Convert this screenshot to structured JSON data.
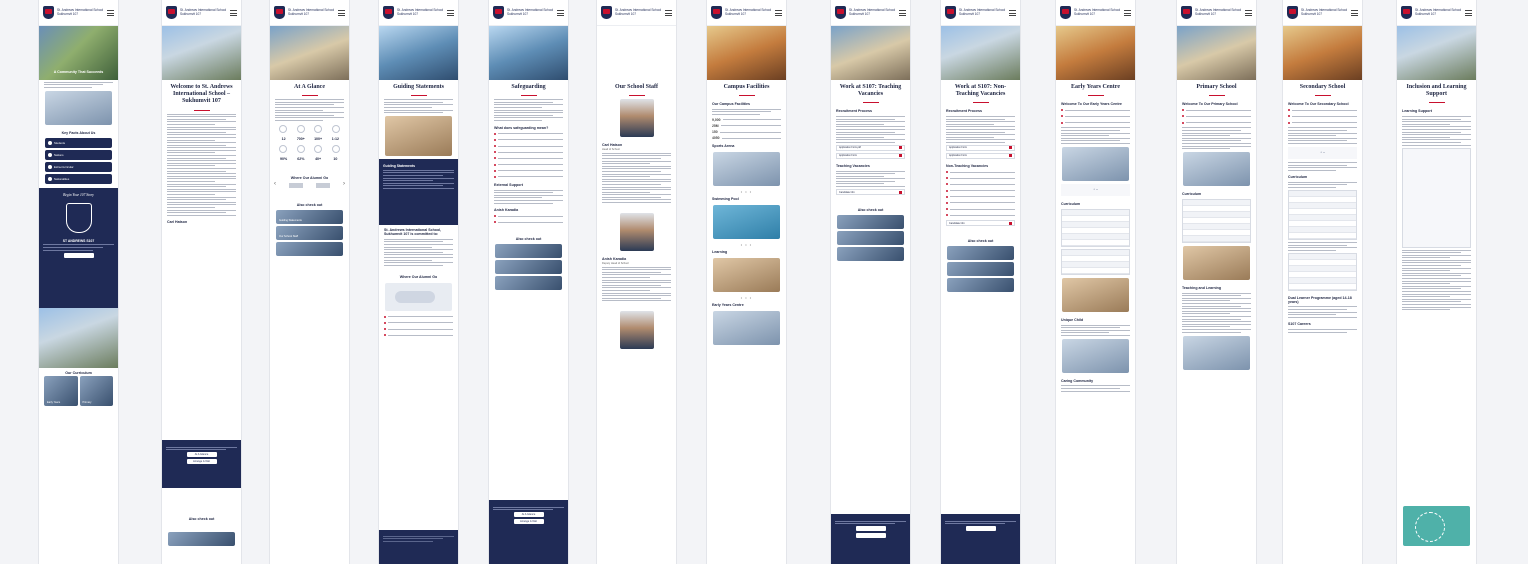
{
  "brand": "St. Andrews International School Sukhumvit 107",
  "screens": [
    {
      "id": "home",
      "hero_caption": "A Community That Succeeds",
      "title": "",
      "tags": [
        "Key Facts About Us",
        "Students",
        "Nations",
        "Extra-Curricular",
        "Nationalities"
      ],
      "extra": [
        "Our Curriculum",
        "Early Years",
        "Primary"
      ],
      "quote": "Begin Your 107 Story",
      "school_name": "ST ANDREWS S107"
    },
    {
      "id": "welcome",
      "title": "Welcome to St. Andrews International School – Sukhumvit 107",
      "sub": "Carl Hatson",
      "also": "Also check out",
      "buttons": [
        "At A Glance",
        "Arrange A Visit"
      ]
    },
    {
      "id": "glance",
      "title": "At A Glance",
      "nums": [
        "12",
        "700+",
        "100+",
        "1:12"
      ],
      "nums2": [
        "90%",
        "62%",
        "40+",
        "10"
      ],
      "sub": "Where Our Alumni Go",
      "also": "Also check out",
      "links": [
        "Guiding Statements",
        "Our School Staff"
      ]
    },
    {
      "id": "guiding",
      "title": "Guiding Statements",
      "sub": "Guiding Statements",
      "sub2": "St. Andrews International School, Sukhumvit 107 is committed to:",
      "also": "Also check out",
      "where": "Where Our Alumni Go"
    },
    {
      "id": "safeguard",
      "title": "Safeguarding",
      "sub": "What does safeguarding mean?",
      "sub2": "External Support",
      "name": "Anish Karadia",
      "also": "Also check out",
      "buttons": [
        "At A Glance",
        "Arrange A Visit"
      ]
    },
    {
      "id": "staff",
      "title": "Our School Staff",
      "person1": "Carl Hatson",
      "role1": "Head of School",
      "person2": "Anish Karadia",
      "role2": "Deputy Head of School"
    },
    {
      "id": "facilities",
      "title": "Campus Facilities",
      "sub": "Our Campus Facilities",
      "stats": [
        "9,000",
        "25M",
        "150",
        "4050"
      ],
      "sections": [
        "Sports Arena",
        "Swimming Pool",
        "Learning",
        "Early Years Centre"
      ]
    },
    {
      "id": "teaching",
      "title": "Work at S107: Teaching Vacancies",
      "sub": "Recruitment Process",
      "sub2": "Teaching Vacancies",
      "also": "Also check out"
    },
    {
      "id": "nonteaching",
      "title": "Work at S107: Non-Teaching Vacancies",
      "sub": "Recruitment Process",
      "sub2": "Non-Teaching Vacancies",
      "also": "Also check out"
    },
    {
      "id": "earlyyears",
      "title": "Early Years Centre",
      "sub": "Welcome To Our Early Years Centre",
      "sub2": "Curriculum",
      "sub3": "Unique Child",
      "sub4": "Caring Community"
    },
    {
      "id": "primary",
      "title": "Primary School",
      "sub": "Welcome To Our Primary School",
      "sub2": "Curriculum",
      "sub3": "Teaching and Learning"
    },
    {
      "id": "secondary",
      "title": "Secondary School",
      "sub": "Welcome To Our Secondary School",
      "sub2": "Curriculum",
      "sub3": "Dual Learner Programme (aged 14-18 years)",
      "sub4": "S107 Careers"
    },
    {
      "id": "inclusion",
      "title": "Inclusion and Learning Support",
      "sub": "Learning Support"
    }
  ]
}
